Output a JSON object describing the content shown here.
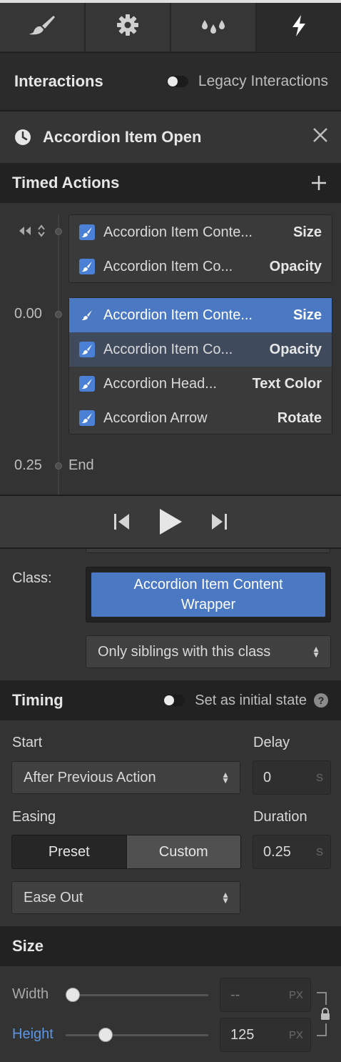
{
  "tabs": [
    {
      "icon": "paintbrush-icon"
    },
    {
      "icon": "gear-icon"
    },
    {
      "icon": "droplets-icon"
    },
    {
      "icon": "lightning-icon",
      "active": true
    }
  ],
  "interactions": {
    "title": "Interactions",
    "legacy_label": "Legacy Interactions"
  },
  "trigger": {
    "title": "Accordion Item Open"
  },
  "timed_actions": {
    "title": "Timed Actions",
    "group1": [
      {
        "name": "Accordion Item Conte...",
        "prop": "Size"
      },
      {
        "name": "Accordion Item Co...",
        "prop": "Opacity"
      }
    ],
    "time_start": "0.00",
    "group2": [
      {
        "name": "Accordion Item Conte...",
        "prop": "Size"
      },
      {
        "name": "Accordion Item Co...",
        "prop": "Opacity"
      },
      {
        "name": "Accordion Head...",
        "prop": "Text Color"
      },
      {
        "name": "Accordion Arrow",
        "prop": "Rotate"
      }
    ],
    "time_end": "0.25",
    "end_label": "End"
  },
  "class_section": {
    "label": "Class:",
    "class_name": "Accordion Item Content Wrapper",
    "scope": "Only siblings with this class"
  },
  "timing": {
    "title": "Timing",
    "initial_state_label": "Set as initial state",
    "help": "?",
    "start_label": "Start",
    "start_value": "After Previous Action",
    "delay_label": "Delay",
    "delay_value": "0",
    "delay_unit": "S",
    "easing_label": "Easing",
    "preset_label": "Preset",
    "custom_label": "Custom",
    "duration_label": "Duration",
    "duration_value": "0.25",
    "duration_unit": "S",
    "ease_value": "Ease Out"
  },
  "size": {
    "title": "Size",
    "width_label": "Width",
    "width_value": "--",
    "width_unit": "PX",
    "height_label": "Height",
    "height_value": "125",
    "height_unit": "PX",
    "height_color": "#5b95e6"
  }
}
